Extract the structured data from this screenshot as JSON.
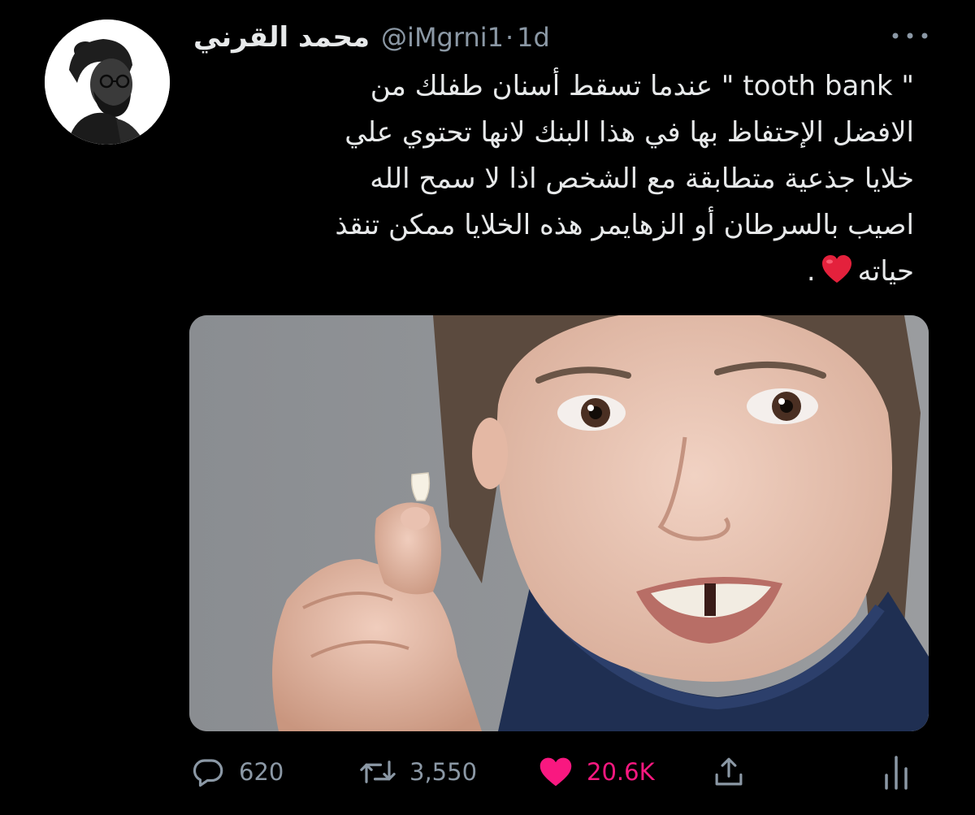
{
  "tweet": {
    "author": {
      "display_name": "محمد القرني",
      "handle": "@iMgrni1",
      "separator": "·",
      "timestamp": "1d",
      "avatar_icon": "profile-photo"
    },
    "text_lines": [
      "\" tooth bank \" عندما تسقط أسنان طفلك من",
      "الافضل الإحتفاظ بها في هذا البنك لانها تحتوي علي",
      "خلايا جذعية متطابقة مع الشخص اذا لا سمح الله",
      "اصيب بالسرطان أو الزهايمر هذه الخلايا ممكن تنقذ",
      "حياته",
      "."
    ],
    "heart_emoji_icon": "red-heart-emoji",
    "media": {
      "description_icon": "photo-child-holding-baby-tooth"
    },
    "actions": {
      "replies": "620",
      "retweets": "3,550",
      "likes": "20.6K",
      "liked": true
    },
    "colors": {
      "background": "#000000",
      "text_primary": "#e7e9ea",
      "text_secondary": "#8b98a5",
      "like_active": "#f91880"
    }
  }
}
